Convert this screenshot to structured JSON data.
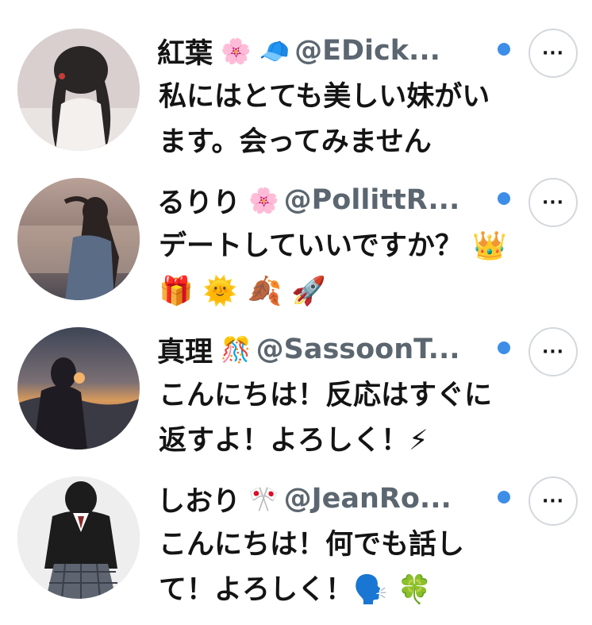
{
  "accent_color": "#3d8ee8",
  "items": [
    {
      "name": "紅葉",
      "emojis": "🌸 🧢",
      "handle": "@EDick...",
      "message": "私にはとても美しい妹がいます。会ってみません",
      "more_label": "···",
      "avatar_desc": "avatar"
    },
    {
      "name": "るりり",
      "emojis": "🌸",
      "handle": "@PollittR...",
      "message": "デートしていいですか？ 👑 🎁 🌞 🍂 🚀",
      "more_label": "···",
      "avatar_desc": "avatar"
    },
    {
      "name": "真理",
      "emojis": "🎊",
      "handle": "@SassoonT...",
      "message": "こんにちは！反応はすぐに返すよ！よろしく！⚡",
      "more_label": "···",
      "avatar_desc": "avatar"
    },
    {
      "name": "しおり",
      "emojis": "🎌",
      "handle": "@JeanRo...",
      "message": "こんにちは！何でも話して！よろしく！🗣️ 🍀",
      "more_label": "···",
      "avatar_desc": "avatar"
    }
  ]
}
